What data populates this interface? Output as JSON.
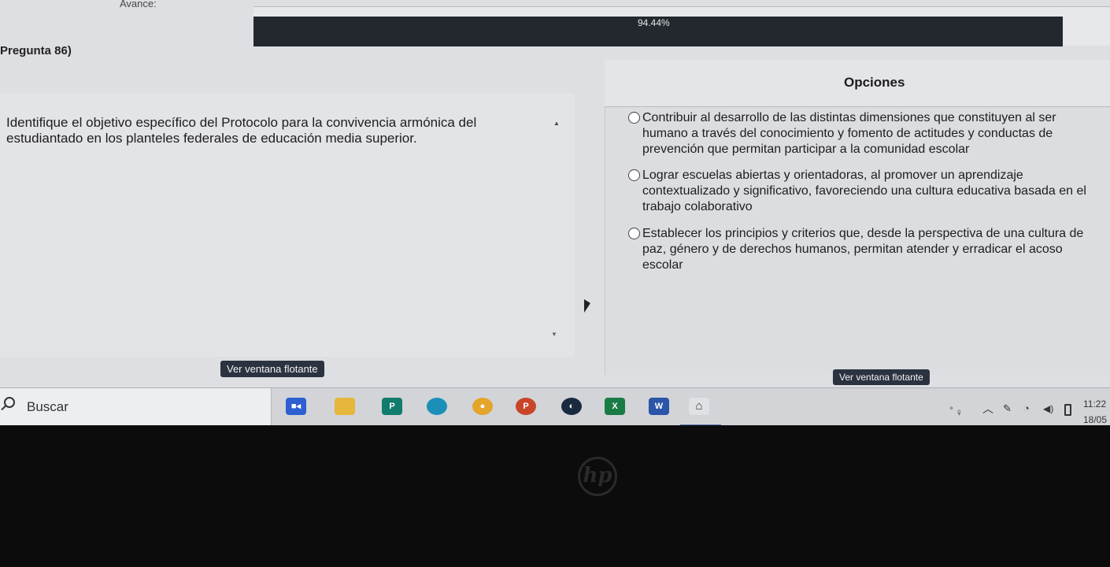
{
  "progress": {
    "label": "Avance:",
    "value_percent": 94.44,
    "text": "94.44%"
  },
  "question": {
    "title": "Pregunta 86)",
    "text": "Identifique el objetivo específico del Protocolo para la convivencia armónica del estudiantado en los planteles federales de educación media superior."
  },
  "options": {
    "title": "Opciones",
    "items": [
      {
        "text": "Contribuir al desarrollo de las distintas dimensiones que constituyen al ser humano a través del conocimiento y fomento de actitudes y conductas de prevención que permitan participar a la comunidad escolar"
      },
      {
        "text": "Lograr escuelas abiertas y orientadoras, al promover un aprendizaje contextualizado y significativo, favoreciendo una cultura educativa basada en el trabajo colaborativo"
      },
      {
        "text": "Establecer los principios y criterios que, desde la perspectiva de una cultura de paz, género y de derechos humanos, permitan atender y erradicar el acoso escolar"
      }
    ]
  },
  "buttons": {
    "float_left": "Ver ventana flotante",
    "float_right": "Ver ventana flotante"
  },
  "taskbar": {
    "search_label": "Buscar",
    "apps": [
      "zoom-icon",
      "file-explorer-icon",
      "publisher-icon",
      "edge-icon",
      "chrome-icon",
      "powerpoint-icon",
      "meet-icon",
      "excel-icon",
      "word-icon",
      "exam-app-icon"
    ],
    "publisher_letter": "P",
    "powerpoint_letter": "P",
    "excel_letter": "X",
    "word_letter": "W",
    "clock_time": "11:22",
    "clock_date": "18/05"
  },
  "colors": {
    "progress_fill": "#23282e",
    "float_button": "#2b3340"
  }
}
